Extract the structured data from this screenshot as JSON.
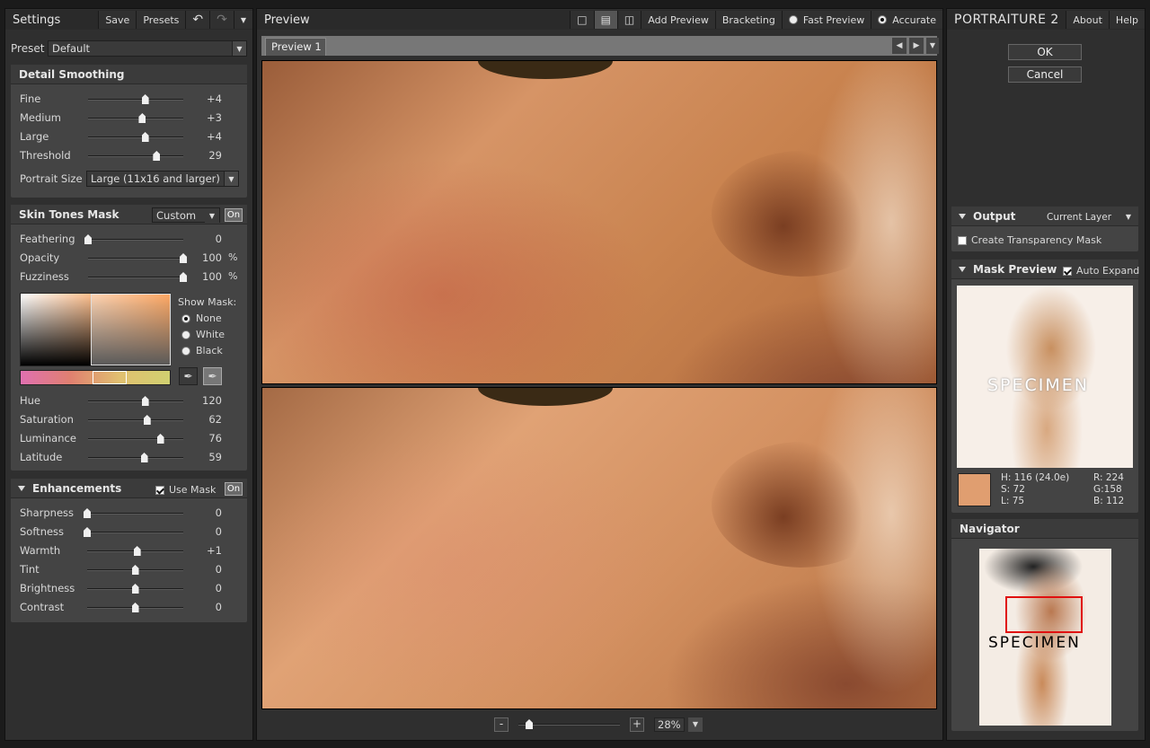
{
  "settings": {
    "title": "Settings",
    "save": "Save",
    "presets": "Presets",
    "preset_label": "Preset",
    "preset_value": "Default"
  },
  "detail": {
    "title": "Detail Smoothing",
    "rows": [
      {
        "label": "Fine",
        "value": "+4",
        "pos": 0.6
      },
      {
        "label": "Medium",
        "value": "+3",
        "pos": 0.57
      },
      {
        "label": "Large",
        "value": "+4",
        "pos": 0.6
      },
      {
        "label": "Threshold",
        "value": "29",
        "pos": 0.72
      }
    ],
    "portrait_label": "Portrait Size",
    "portrait_value": "Large (11x16 and larger)"
  },
  "skin": {
    "title": "Skin Tones Mask",
    "mode": "Custom",
    "on": "On",
    "rows": [
      {
        "label": "Feathering",
        "value": "0",
        "unit": "",
        "pos": 0
      },
      {
        "label": "Opacity",
        "value": "100",
        "unit": "%",
        "pos": 1
      },
      {
        "label": "Fuzziness",
        "value": "100",
        "unit": "%",
        "pos": 1
      }
    ],
    "show_mask": "Show Mask:",
    "mask_options": [
      "None",
      "White",
      "Black"
    ],
    "hsl": [
      {
        "label": "Hue",
        "value": "120",
        "pos": 0.6
      },
      {
        "label": "Saturation",
        "value": "62",
        "pos": 0.62
      },
      {
        "label": "Luminance",
        "value": "76",
        "pos": 0.76
      },
      {
        "label": "Latitude",
        "value": "59",
        "pos": 0.59
      }
    ]
  },
  "enh": {
    "title": "Enhancements",
    "use_mask": "Use Mask",
    "on": "On",
    "rows": [
      {
        "label": "Sharpness",
        "value": "0",
        "pos": 0
      },
      {
        "label": "Softness",
        "value": "0",
        "pos": 0
      },
      {
        "label": "Warmth",
        "value": "+1",
        "pos": 0.52
      },
      {
        "label": "Tint",
        "value": "0",
        "pos": 0.5
      },
      {
        "label": "Brightness",
        "value": "0",
        "pos": 0.5
      },
      {
        "label": "Contrast",
        "value": "0",
        "pos": 0.5
      }
    ]
  },
  "preview": {
    "title": "Preview",
    "add_preview": "Add Preview",
    "bracketing": "Bracketing",
    "fast_preview": "Fast Preview",
    "accurate": "Accurate",
    "tab": "Preview 1",
    "zoom": "28%",
    "minus": "-",
    "plus": "+"
  },
  "right": {
    "brand": "PORTRAITURE",
    "version": "2",
    "about": "About",
    "help": "Help",
    "ok": "OK",
    "cancel": "Cancel",
    "output": "Output",
    "output_value": "Current Layer",
    "transparency": "Create Transparency Mask",
    "mask_preview": "Mask Preview",
    "auto_expand": "Auto Expand",
    "specimen": "SPECIMEN",
    "h": "H: 116 (24.0e)",
    "s": "S: 72",
    "l": "L: 75",
    "r": "R: 224",
    "g": "G:158",
    "b": "B: 112",
    "navigator": "Navigator",
    "swatch": "#e09e70"
  }
}
